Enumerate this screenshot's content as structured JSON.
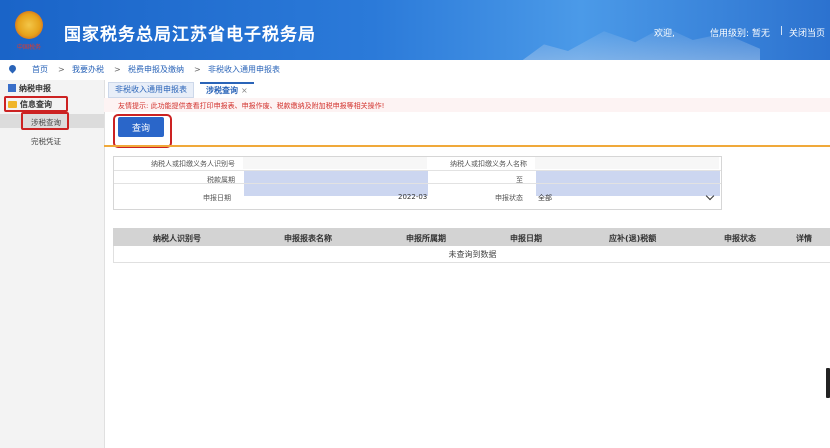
{
  "header": {
    "title": "国家税务总局江苏省电子税务局",
    "emblem_text": "中国税务",
    "welcome": "欢迎,",
    "credit": "信用级别: 暂无",
    "separator": "|",
    "close": "关闭当页"
  },
  "breadcrumb": {
    "items": [
      "首页",
      ">",
      "我要办税",
      ">",
      "税费申报及缴纳",
      ">",
      "非税收入通用申报表"
    ]
  },
  "sidebar": {
    "items": [
      {
        "label": "纳税申报"
      },
      {
        "label": "信息查询"
      }
    ],
    "sub_items": [
      {
        "label": "涉税查询"
      },
      {
        "label": "完税凭证"
      }
    ]
  },
  "tabs": [
    {
      "label": "非税收入通用申报表"
    },
    {
      "label": "涉税查询",
      "close": "×"
    }
  ],
  "notice": "友情提示: 此功能提供查看打印申报表、申报作废、税款缴纳及附加税申报等相关操作!",
  "query_button": "查询",
  "form": {
    "taxpayer_id_label": "纳税人或扣缴义务人识别号",
    "taxpayer_name_label": "纳税人或扣缴义务人名称",
    "tax_period_label": "税款属期",
    "to_label": "至",
    "declare_date_label": "申报日期",
    "declare_date_value": "2022-03",
    "status_label": "申报状态",
    "status_value": "全部"
  },
  "table": {
    "columns": [
      "纳税人识别号",
      "申报报表名称",
      "申报所属期",
      "申报日期",
      "应补(退)税额",
      "申报状态",
      "详情"
    ],
    "empty_text": "未查询到数据"
  },
  "colors": {
    "brand_blue": "#2a66c9",
    "highlight_red": "#cc2222",
    "accent_orange": "#f0a93a"
  }
}
